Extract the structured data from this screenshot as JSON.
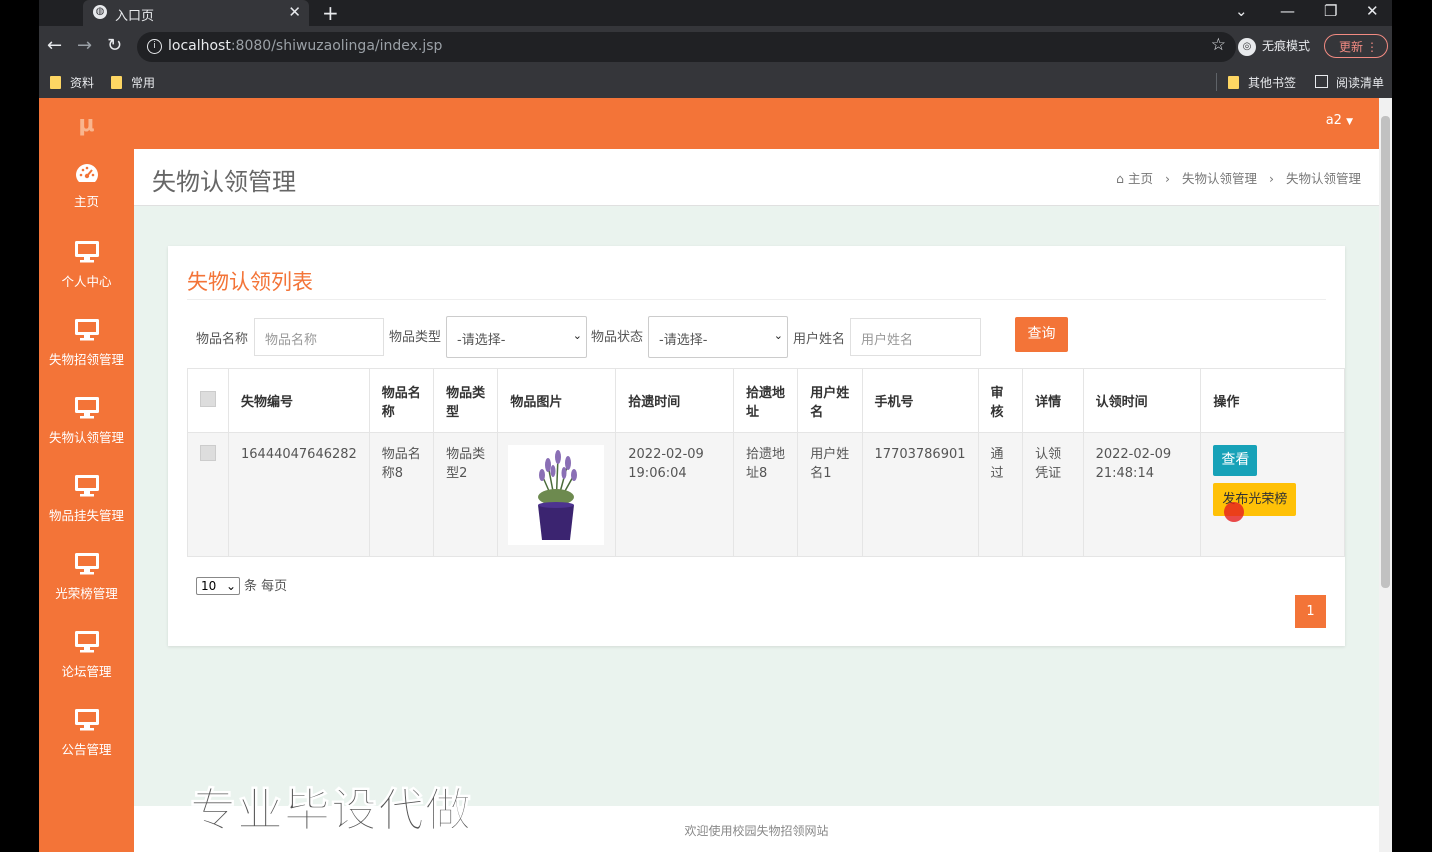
{
  "browser": {
    "tab_title": "入口页",
    "tab_close": "✕",
    "new_tab": "+",
    "url_host": "localhost",
    "url_path": ":8080/shiwuzaolinga/index.jsp",
    "incognito_label": "无痕模式",
    "update_label": "更新",
    "bookmarks": [
      "资料",
      "常用"
    ],
    "other_bookmarks": "其他书签",
    "reading_list": "阅读清单"
  },
  "sidebar": {
    "items": [
      {
        "label": "主页",
        "icon": "dashboard-icon"
      },
      {
        "label": "个人中心",
        "icon": "monitor-icon"
      },
      {
        "label": "失物招领管理",
        "icon": "monitor-icon"
      },
      {
        "label": "失物认领管理",
        "icon": "monitor-icon"
      },
      {
        "label": "物品挂失管理",
        "icon": "monitor-icon"
      },
      {
        "label": "光荣榜管理",
        "icon": "monitor-icon"
      },
      {
        "label": "论坛管理",
        "icon": "monitor-icon"
      },
      {
        "label": "公告管理",
        "icon": "monitor-icon"
      }
    ]
  },
  "header": {
    "user": "a2"
  },
  "page": {
    "title": "失物认领管理",
    "breadcrumb": [
      "主页",
      "失物认领管理",
      "失物认领管理"
    ]
  },
  "card": {
    "title": "失物认领列表",
    "filters": {
      "item_name_label": "物品名称",
      "item_name_placeholder": "物品名称",
      "item_type_label": "物品类型",
      "item_type_value": "-请选择-",
      "item_status_label": "物品状态",
      "item_status_value": "-请选择-",
      "user_name_label": "用户姓名",
      "user_name_placeholder": "用户姓名",
      "query_label": "查询"
    },
    "table": {
      "headers": [
        "失物编号",
        "物品名称",
        "物品类型",
        "物品图片",
        "拾遗时间",
        "拾遗地址",
        "用户姓名",
        "手机号",
        "审核",
        "详情",
        "认领时间",
        "操作"
      ],
      "rows": [
        {
          "id": "16444047646282",
          "name": "物品名称8",
          "type": "物品类型2",
          "pick_time": "2022-02-09 19:06:04",
          "address": "拾遗地址8",
          "user": "用户姓名1",
          "phone": "17703786901",
          "audit": "通过",
          "detail": "认领凭证",
          "claim_time": "2022-02-09 21:48:14",
          "view_label": "查看",
          "publish_label": "发布光荣榜"
        }
      ]
    },
    "page_size_value": "10",
    "page_size_suffix": "条 每页",
    "current_page": "1"
  },
  "footer": {
    "text": "欢迎使用校园失物招领网站"
  },
  "watermark": "专业毕设代做",
  "colors": {
    "accent": "#f37438",
    "view_button": "#17a2b8",
    "publish_button": "#ffc107"
  }
}
